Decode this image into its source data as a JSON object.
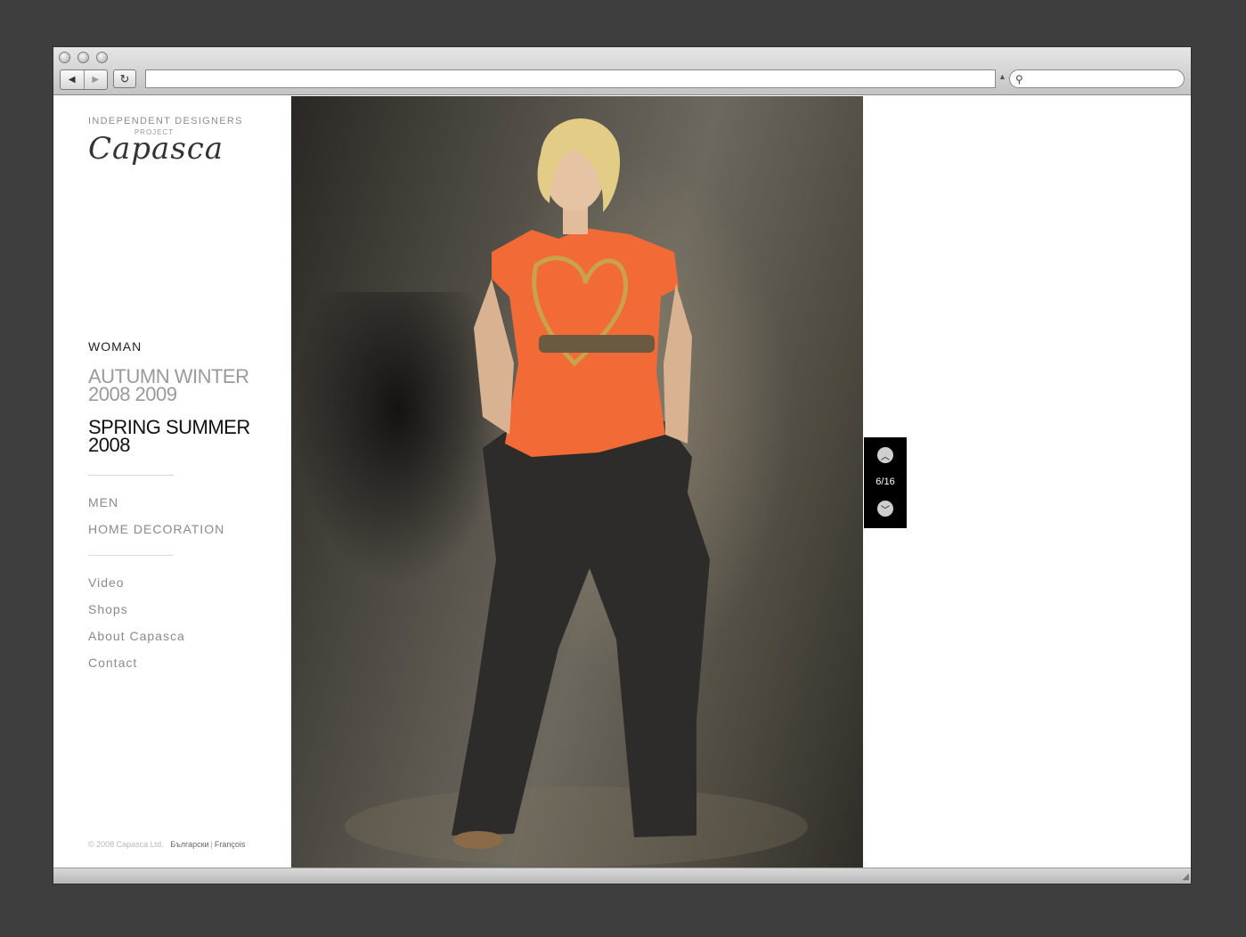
{
  "browser": {
    "address_value": "",
    "search_placeholder": ""
  },
  "brand": {
    "tagline": "INDEPENDENT DESIGNERS",
    "subtag": "PROJECT",
    "logo_script": "Capasca"
  },
  "nav": {
    "woman": "WOMAN",
    "seasons": [
      {
        "line1": "AUTUMN WINTER",
        "line2": "2008 2009"
      },
      {
        "line1": "SPRING SUMMER",
        "line2": "2008"
      }
    ],
    "sections": [
      "MEN",
      "HOME DECORATION"
    ],
    "links": [
      "Video",
      "Shops",
      "About Capasca",
      "Contact"
    ]
  },
  "footer": {
    "copyright": "© 2008 Capasca Ltd.",
    "languages": [
      "Български",
      "François"
    ]
  },
  "gallery": {
    "counter": "6/16",
    "up_icon": "chevron-up-icon",
    "down_icon": "chevron-down-icon",
    "top_color": "#f26a35",
    "pants_color": "#2d2c2a"
  }
}
